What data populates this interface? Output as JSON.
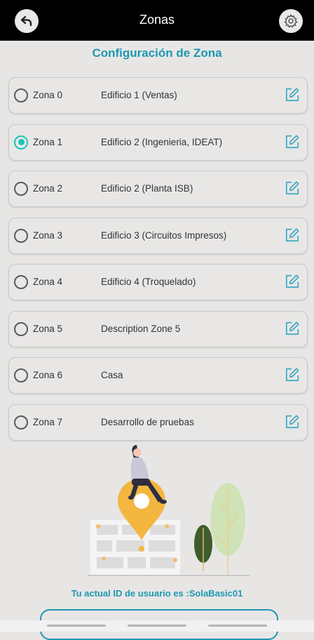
{
  "header": {
    "title": "Zonas",
    "back_icon": "back-arrow-icon",
    "settings_icon": "gear-icon"
  },
  "section_title": "Configuración de Zona",
  "zones": [
    {
      "name": "Zona 0",
      "description": "Edificio 1 (Ventas)",
      "selected": false
    },
    {
      "name": "Zona 1",
      "description": "Edificio 2 (Ingenieria, IDEAT)",
      "selected": true
    },
    {
      "name": "Zona 2",
      "description": "Edificio 2 (Planta ISB)",
      "selected": false
    },
    {
      "name": "Zona 3",
      "description": "Edificio 3 (Circuitos Impresos)",
      "selected": false
    },
    {
      "name": "Zona 4",
      "description": "Edificio 4 (Troquelado)",
      "selected": false
    },
    {
      "name": "Zona 5",
      "description": "Description Zone 5",
      "selected": false
    },
    {
      "name": "Zona 6",
      "description": "Casa",
      "selected": false
    },
    {
      "name": "Zona 7",
      "description": "Desarrollo de pruebas",
      "selected": false
    }
  ],
  "user_id_text": "Tu actual ID de usuario es  :SolaBasic01",
  "colors": {
    "accent": "#1e98b0",
    "radio_selected": "#19c7b5",
    "edit_icon": "#3aa8c4",
    "background": "#e7e6e5"
  }
}
